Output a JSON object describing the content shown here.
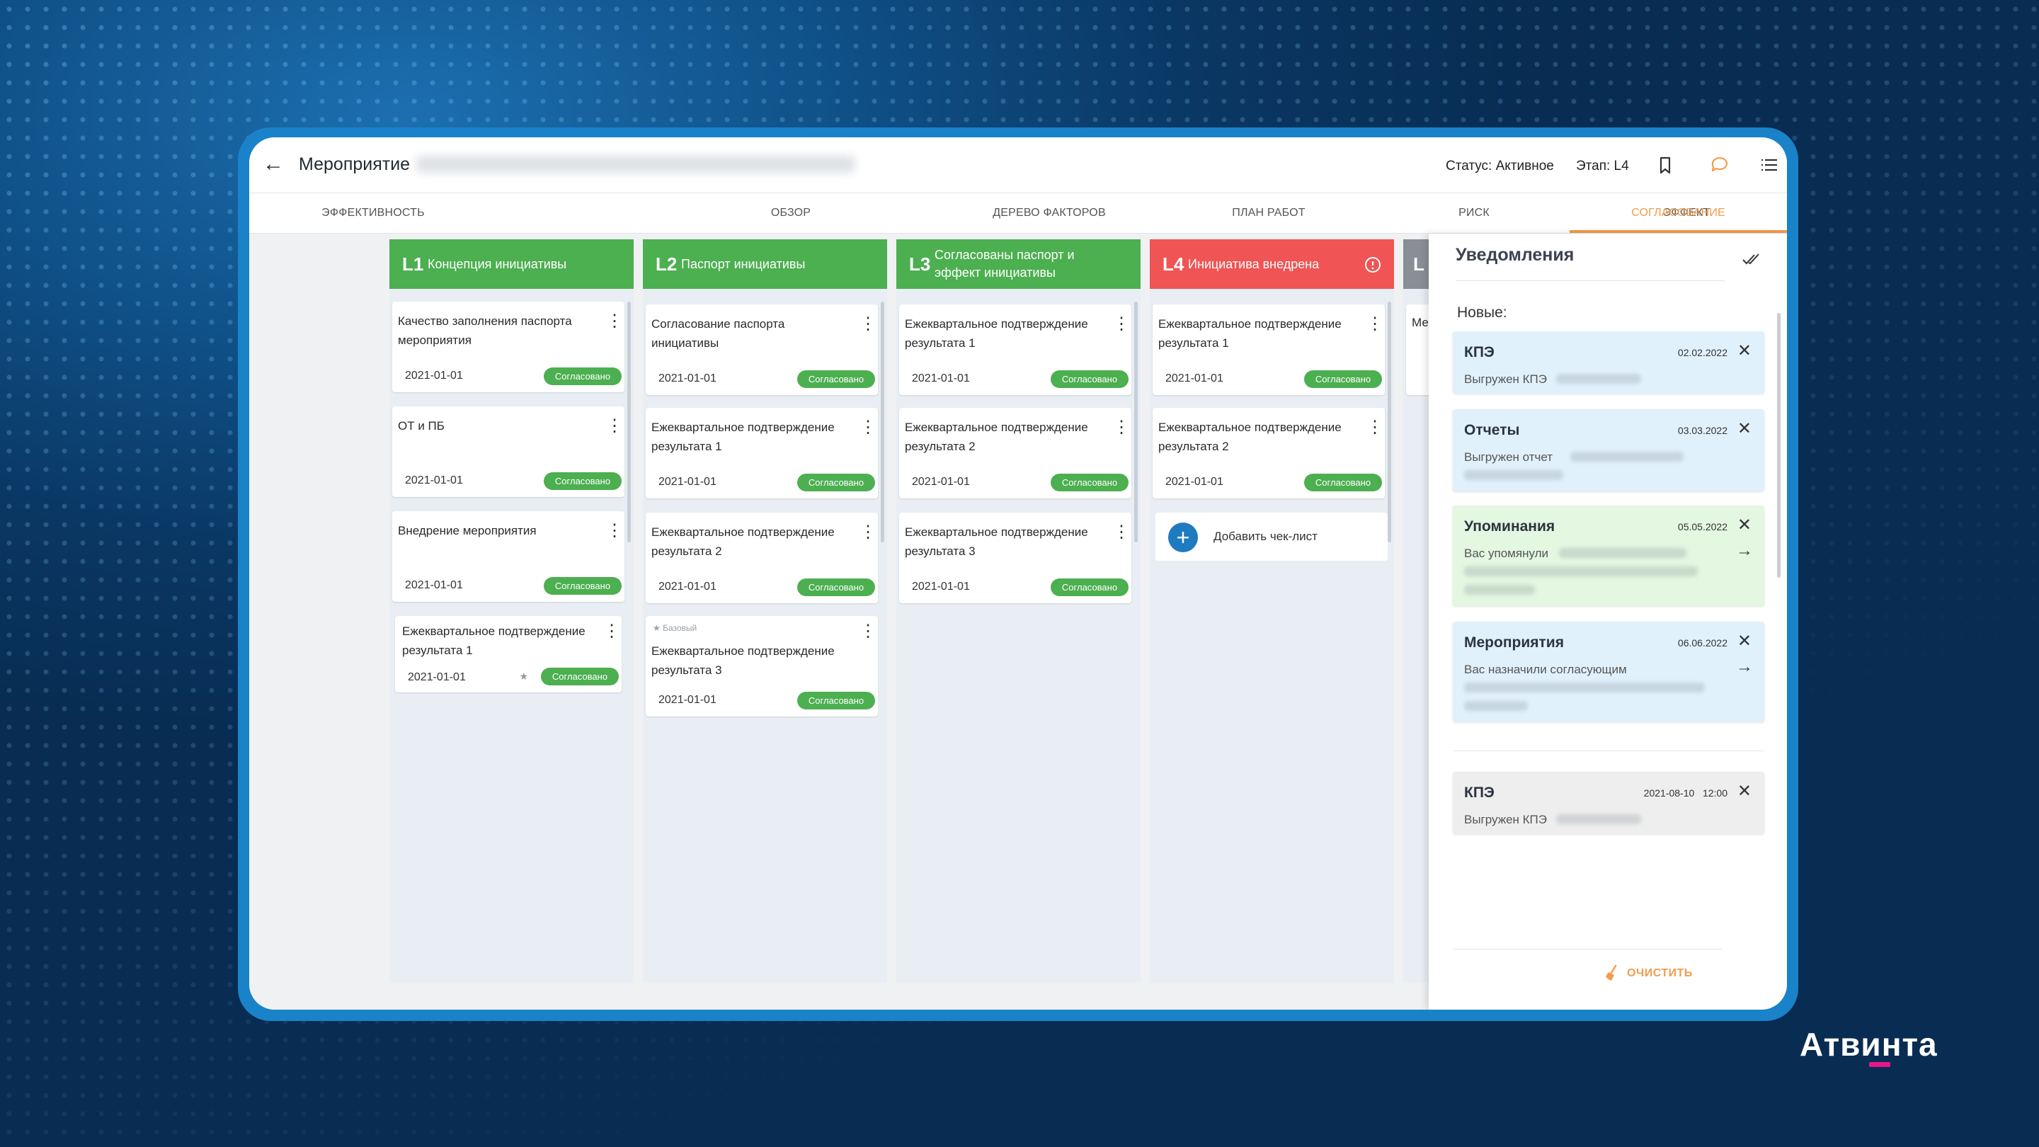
{
  "header": {
    "back_icon": "arrow-left-icon",
    "title": "Мероприятие",
    "status": "Статус: Активное",
    "stage": "Этап: L4",
    "icons": [
      "bookmark-icon",
      "comment-icon",
      "list-icon"
    ]
  },
  "tabs": [
    {
      "label": "ЭФФЕКТИВНОСТЬ"
    },
    {
      "label": "ОБЗОР"
    },
    {
      "label": "ДЕРЕВО ФАКТОРОВ"
    },
    {
      "label": "ПЛАН РАБОТ"
    },
    {
      "label": "РИСК"
    },
    {
      "label": "ЭФФЕКТ"
    },
    {
      "label": "СОГЛАСОВАНИЕ",
      "active": true
    }
  ],
  "columns": [
    {
      "num": "L1",
      "title": "Концепция инициативы",
      "color": "#4caf50",
      "cards": [
        {
          "text": "Качество заполнения паспорта мероприятия",
          "date": "2021-01-01",
          "badge": "Согласовано"
        },
        {
          "text": "ОТ и ПБ",
          "date": "2021-01-01",
          "badge": "Согласовано"
        },
        {
          "text": "Внедрение мероприятия",
          "date": "2021-01-01",
          "badge": "Согласовано"
        },
        {
          "text": "Ежеквартальное подтверждение результата 1",
          "date": "2021-01-01",
          "badge": "Согласовано",
          "star": "★"
        }
      ]
    },
    {
      "num": "L2",
      "title": "Паспорт инициативы",
      "color": "#4caf50",
      "cards": [
        {
          "text": "Согласование паспорта инициативы",
          "date": "2021-01-01",
          "badge": "Согласовано"
        },
        {
          "text": "Ежеквартальное подтверждение результата 1",
          "date": "2021-01-01",
          "badge": "Согласовано"
        },
        {
          "text": "Ежеквартальное подтверждение результата 2",
          "date": "2021-01-01",
          "badge": "Согласовано"
        },
        {
          "label": "Базовый",
          "text": "Ежеквартальное подтверждение результата 3",
          "date": "2021-01-01",
          "badge": "Согласовано"
        }
      ]
    },
    {
      "num": "L3",
      "title": "Согласованы паспорт и эффект инициативы",
      "color": "#4caf50",
      "cards": [
        {
          "text": "Ежеквартальное подтверждение результата 1",
          "date": "2021-01-01",
          "badge": "Согласовано"
        },
        {
          "text": "Ежеквартальное подтверждение результата 2",
          "date": "2021-01-01",
          "badge": "Согласовано"
        },
        {
          "text": "Ежеквартальное подтверждение результата 3",
          "date": "2021-01-01",
          "badge": "Согласовано"
        }
      ]
    },
    {
      "num": "L4",
      "title": "Инициатива внедрена",
      "color": "#f05454",
      "cards": [
        {
          "text": "Ежеквартальное подтверждение результата 1",
          "date": "2021-01-01",
          "badge": "Согласовано"
        },
        {
          "text": "Ежеквартальное подтверждение результата 2",
          "date": "2021-01-01",
          "badge": "Согласовано"
        }
      ],
      "add_label": "Добавить чек-лист"
    },
    {
      "num": "L",
      "title": "",
      "color": "#8a8f96",
      "cards": [
        {
          "text": "Ме"
        }
      ]
    }
  ],
  "notifications": {
    "title": "Уведомления",
    "new_label": "Новые:",
    "items": [
      {
        "title": "КПЭ",
        "date": "02.02.2022",
        "text": "Выгружен КПЭ",
        "color": "#e1f1fc"
      },
      {
        "title": "Отчеты",
        "date": "03.03.2022",
        "text": "Выгружен отчет",
        "color": "#e1f1fc"
      },
      {
        "title": "Упоминания",
        "date": "05.05.2022",
        "text": "Вас упомянули",
        "color": "#e3f7e1"
      },
      {
        "title": "Мероприятия",
        "date": "06.06.2022",
        "text": "Вас назначили согласующим",
        "color": "#e1f1fc"
      }
    ],
    "old": [
      {
        "title": "КПЭ",
        "date": "2021-08-10   12:00",
        "text": "Выгружен КПЭ",
        "color": "#eeeeee"
      }
    ],
    "clear_label": "ОЧИСТИТЬ"
  },
  "logo": "Атвинта"
}
